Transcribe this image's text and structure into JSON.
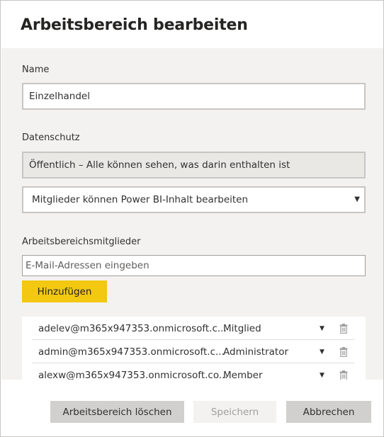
{
  "dialog": {
    "title": "Arbeitsbereich bearbeiten"
  },
  "name_section": {
    "label": "Name",
    "value": "Einzelhandel"
  },
  "privacy_section": {
    "label": "Datenschutz",
    "privacy_value": "Öffentlich – Alle können sehen, was darin enthalten ist",
    "permission_value": "Mitglieder können Power BI-Inhalt bearbeiten",
    "caret": "▼"
  },
  "members_section": {
    "label": "Arbeitsbereichsmitglieder",
    "email_placeholder": "E-Mail-Adressen eingeben",
    "add_label": "Hinzufügen",
    "rows": [
      {
        "email": "adelev@m365x947353.onmicrosoft.c...",
        "role": "Mitglied"
      },
      {
        "email": "admin@m365x947353.onmicrosoft.c...",
        "role": "Administrator"
      },
      {
        "email": "alexw@m365x947353.onmicrosoft.co...",
        "role": "Member"
      }
    ],
    "row_caret": "▼",
    "icons": {
      "remove": "trash-icon",
      "dropdown": "chevron-down-icon"
    }
  },
  "footer": {
    "delete_label": "Arbeitsbereich löschen",
    "save_label": "Speichern",
    "cancel_label": "Abbrechen"
  },
  "colors": {
    "accent_yellow": "#f2c811",
    "panel_background": "#f3f2f1",
    "button_gray": "#d2d0ce"
  }
}
